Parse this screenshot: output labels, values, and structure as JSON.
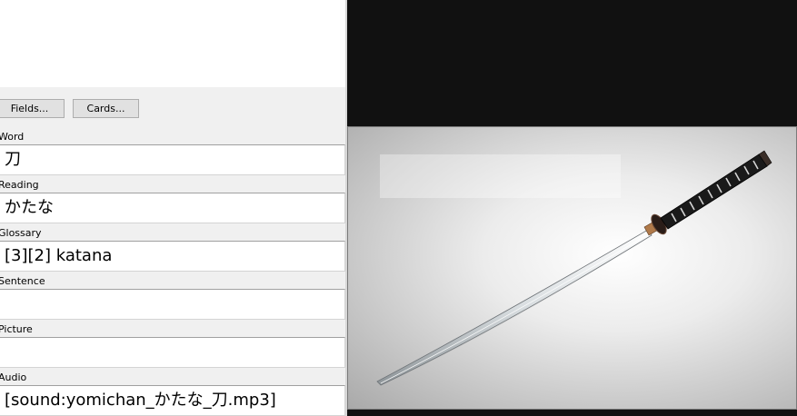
{
  "editor": {
    "buttons": {
      "fields": "Fields...",
      "cards": "Cards..."
    },
    "fields": [
      {
        "label": "Word",
        "value": "刀"
      },
      {
        "label": "Reading",
        "value": "かたな"
      },
      {
        "label": "Glossary",
        "value": "[3][2] katana"
      },
      {
        "label": "Sentence",
        "value": ""
      },
      {
        "label": "Picture",
        "value": ""
      },
      {
        "label": "Audio",
        "value": "[sound:yomichan_かたな_刀.mp3]"
      }
    ]
  },
  "preview": {
    "image_subject": "katana-image",
    "background_color": "#111111"
  }
}
